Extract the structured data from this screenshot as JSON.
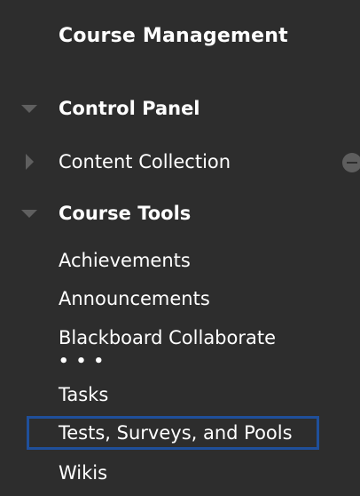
{
  "menu": {
    "heading": "Course Management",
    "control_panel": "Control Panel",
    "content_collection": "Content Collection",
    "course_tools": "Course Tools",
    "tools": [
      "Achievements",
      "Announcements",
      "Blackboard Collaborate",
      "Tasks",
      "Tests, Surveys, and Pools",
      "Wikis"
    ],
    "ellipsis": "• • •"
  },
  "colors": {
    "background": "#2d2d2d",
    "text": "#ffffff",
    "highlight_border": "#1f4f9a",
    "toggle_gray": "#5f5f5f"
  }
}
